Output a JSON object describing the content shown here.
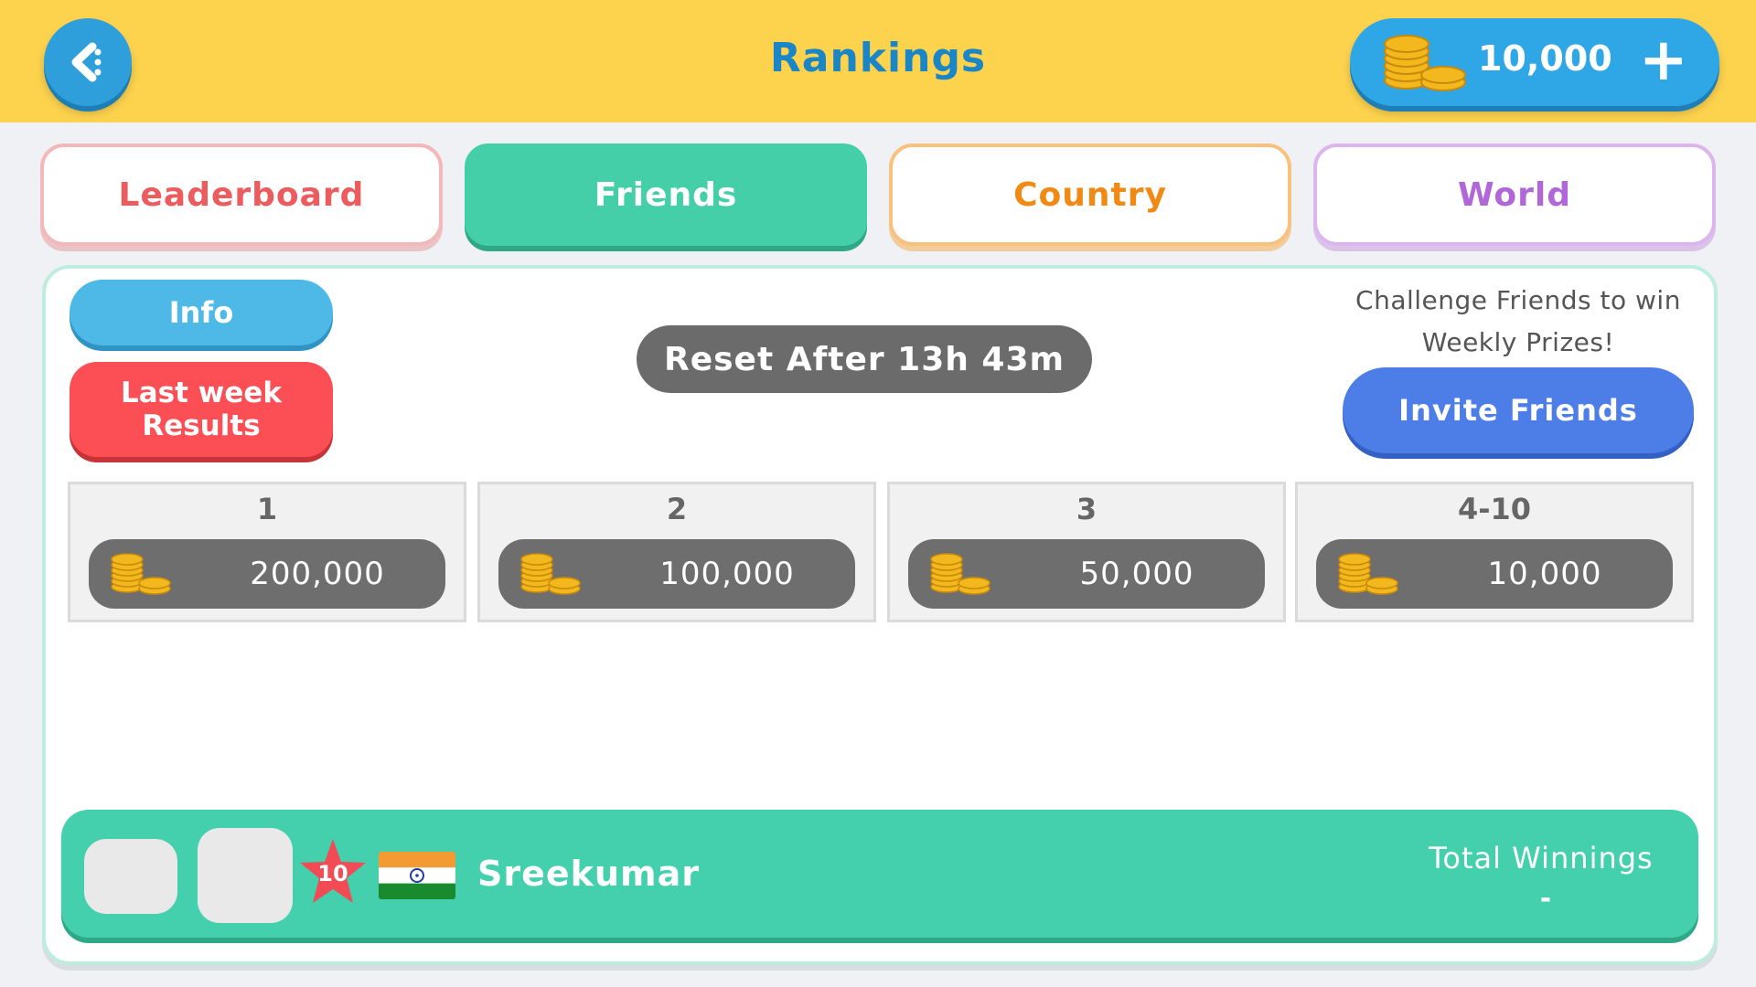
{
  "header": {
    "title": "Rankings",
    "coin_balance": "10,000",
    "add_coins_symbol": "+"
  },
  "tabs": [
    {
      "label": "Leaderboard",
      "color": "#ec5b5d"
    },
    {
      "label": "Friends",
      "color": "#44cfa8",
      "selected": true
    },
    {
      "label": "Country",
      "color": "#f08a14"
    },
    {
      "label": "World",
      "color": "#b067d8"
    }
  ],
  "panel": {
    "info_label": "Info",
    "last_week_label": "Last week Results",
    "reset_text": "Reset After 13h 43m",
    "challenge_text": "Challenge Friends to win Weekly Prizes!",
    "invite_label": "Invite Friends"
  },
  "prizes": [
    {
      "rank": "1",
      "amount": "200,000"
    },
    {
      "rank": "2",
      "amount": "100,000"
    },
    {
      "rank": "3",
      "amount": "50,000"
    },
    {
      "rank": "4-10",
      "amount": "10,000"
    }
  ],
  "player": {
    "level": "10",
    "name": "Sreekumar",
    "total_winnings_label": "Total Winnings",
    "total_winnings_value": "-"
  },
  "colors": {
    "header_bg": "#fdd34e",
    "accent_blue": "#2f9fdc",
    "accent_green": "#44cfa8",
    "danger_red": "#fb4f55",
    "invite_blue": "#4d7ee8"
  }
}
